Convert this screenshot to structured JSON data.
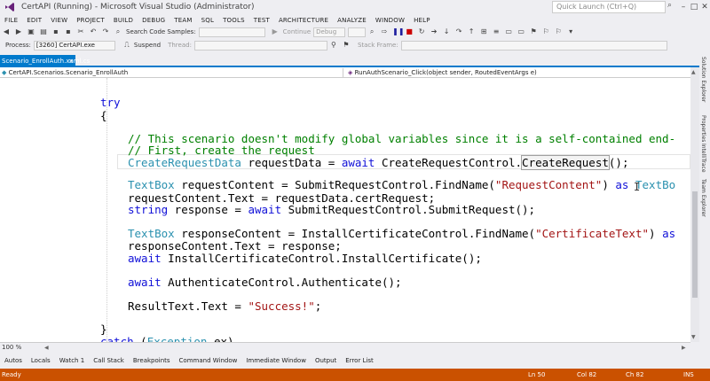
{
  "window": {
    "title": "CertAPI (Running) - Microsoft Visual Studio (Administrator)",
    "quick_launch_placeholder": "Quick Launch (Ctrl+Q)",
    "minimize": "–",
    "maximize": "□",
    "close": "✕"
  },
  "menu": [
    "FILE",
    "EDIT",
    "VIEW",
    "PROJECT",
    "BUILD",
    "DEBUG",
    "TEAM",
    "SQL",
    "TOOLS",
    "TEST",
    "ARCHITECTURE",
    "ANALYZE",
    "WINDOW",
    "HELP"
  ],
  "toolbar": {
    "search_label": "Search Code Samples:",
    "continue_label": "Continue",
    "config_value": "Debug",
    "stack_frame_label": "Stack Frame:"
  },
  "toolbar2": {
    "process_label": "Process:",
    "process_value": "[3260] CertAPI.exe",
    "suspend_label": "Suspend",
    "thread_label": "Thread:"
  },
  "document_tab": {
    "name": "Scenario_EnrollAuth.xaml.cs",
    "close": "×"
  },
  "nav": {
    "class_combo": "CertAPI.Scenarios.Scenario_EnrollAuth",
    "member_combo": "RunAuthScenario_Click(object sender, RoutedEventArgs e)"
  },
  "code_lines": [
    [
      {
        "t": "try",
        "c": "kw"
      }
    ],
    [
      {
        "t": "{",
        "c": ""
      }
    ],
    [
      {
        "t": "// This scenario doesn't modify global variables since it is a self-contained end-",
        "c": "cm"
      }
    ],
    [
      {
        "t": "// First, create the request",
        "c": "cm"
      }
    ],
    [
      {
        "t": "CreateRequestData",
        "c": "tp"
      },
      {
        "t": " requestData = ",
        "c": ""
      },
      {
        "t": "await",
        "c": "kw"
      },
      {
        "t": " CreateRequestControl.",
        "c": ""
      },
      {
        "t": "CreateRequest",
        "c": "hl"
      },
      {
        "t": "();",
        "c": ""
      }
    ],
    [
      {
        "t": "TextBox",
        "c": "tp"
      },
      {
        "t": " requestContent = SubmitRequestControl.FindName(",
        "c": ""
      },
      {
        "t": "\"RequestContent\"",
        "c": "st"
      },
      {
        "t": ") ",
        "c": ""
      },
      {
        "t": "as",
        "c": "kw"
      },
      {
        "t": " ",
        "c": ""
      },
      {
        "t": "TextBo",
        "c": "tp"
      }
    ],
    [
      {
        "t": "requestContent.Text = requestData.certRequest;",
        "c": ""
      }
    ],
    [
      {
        "t": "string",
        "c": "kw"
      },
      {
        "t": " response = ",
        "c": ""
      },
      {
        "t": "await",
        "c": "kw"
      },
      {
        "t": " SubmitRequestControl.SubmitRequest();",
        "c": ""
      }
    ],
    [
      {
        "t": "TextBox",
        "c": "tp"
      },
      {
        "t": " responseContent = InstallCertificateControl.FindName(",
        "c": ""
      },
      {
        "t": "\"CertificateText\"",
        "c": "st"
      },
      {
        "t": ") ",
        "c": ""
      },
      {
        "t": "as",
        "c": "kw"
      }
    ],
    [
      {
        "t": "responseContent.Text = response;",
        "c": ""
      }
    ],
    [
      {
        "t": "await",
        "c": "kw"
      },
      {
        "t": " InstallCertificateControl.InstallCertificate();",
        "c": ""
      }
    ],
    [
      {
        "t": "await",
        "c": "kw"
      },
      {
        "t": " AuthenticateControl.Authenticate();",
        "c": ""
      }
    ],
    [
      {
        "t": "ResultText.Text = ",
        "c": ""
      },
      {
        "t": "\"Success!\"",
        "c": "st"
      },
      {
        "t": ";",
        "c": ""
      }
    ],
    [
      {
        "t": "}",
        "c": ""
      }
    ],
    [
      {
        "t": "catch",
        "c": "kw"
      },
      {
        "t": " (",
        "c": ""
      },
      {
        "t": "Exception",
        "c": "tp"
      },
      {
        "t": " ex)",
        "c": ""
      }
    ]
  ],
  "side_panel": [
    "Solution Explorer",
    "Properties",
    "IntelliTrace",
    "Team Explorer"
  ],
  "zoom": "100 %",
  "bottom_tabs": [
    "Autos",
    "Locals",
    "Watch 1",
    "Call Stack",
    "Breakpoints",
    "Command Window",
    "Immediate Window",
    "Output",
    "Error List"
  ],
  "status": {
    "ready": "Ready",
    "line": "Ln 50",
    "col": "Col 82",
    "ch": "Ch 82",
    "mode": "INS"
  }
}
